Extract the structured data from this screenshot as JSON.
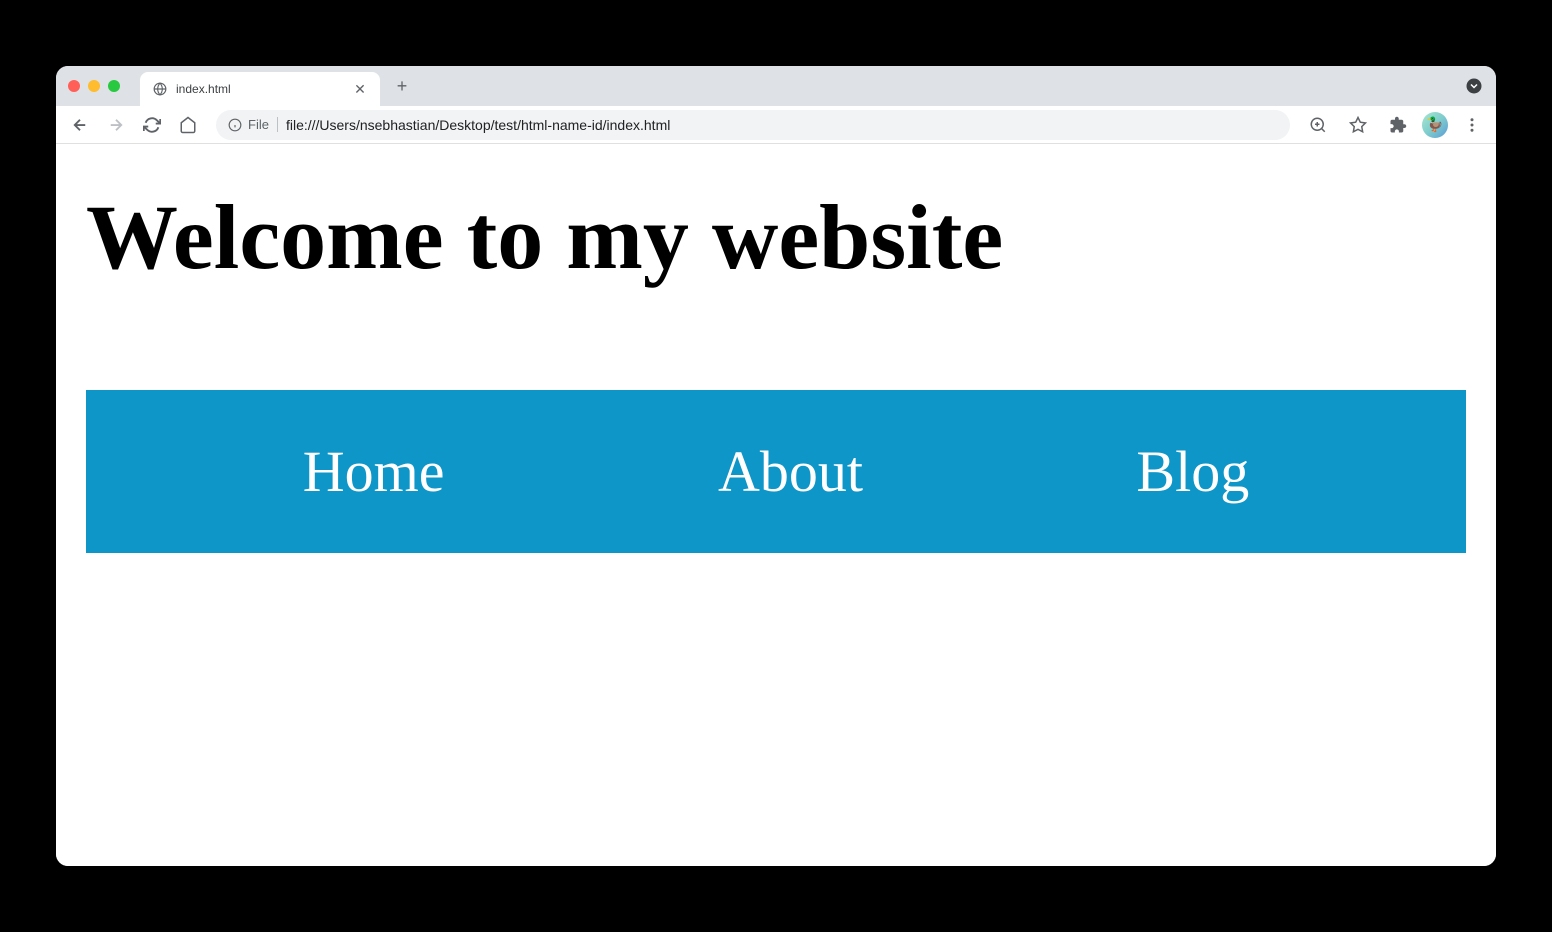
{
  "browser": {
    "tab": {
      "title": "index.html"
    },
    "url_prefix": "File",
    "url": "file:///Users/nsebhastian/Desktop/test/html-name-id/index.html"
  },
  "page": {
    "heading": "Welcome to my website",
    "nav": {
      "home": "Home",
      "about": "About",
      "blog": "Blog"
    }
  }
}
